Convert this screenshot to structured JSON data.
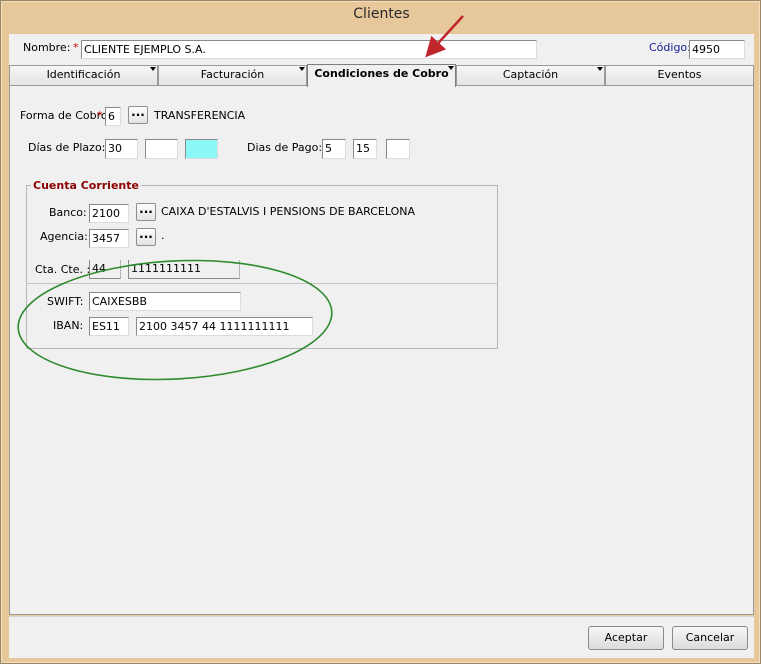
{
  "window": {
    "title": "Clientes"
  },
  "client": {
    "nombre_label": "Nombre:",
    "nombre_value": "CLIENTE EJEMPLO S.A.",
    "codigo_label": "Código:",
    "codigo_value": "4950",
    "required_mark": "*"
  },
  "tabs": [
    {
      "label": "Identificación"
    },
    {
      "label": "Facturación"
    },
    {
      "label": "Condiciones de Cobro"
    },
    {
      "label": "Captación"
    },
    {
      "label": "Eventos"
    }
  ],
  "cobro": {
    "forma_label": "Forma de Cobro:",
    "forma_code": "6",
    "forma_desc": "TRANSFERENCIA",
    "dias_plazo_label": "Días de Plazo:",
    "dias_plazo": [
      "30",
      "",
      ""
    ],
    "dias_pago_label": "Dias de Pago:",
    "dias_pago": [
      "5",
      "15",
      ""
    ],
    "dots": "..."
  },
  "cuenta": {
    "title": "Cuenta Corriente",
    "banco_label": "Banco:",
    "banco_code": "2100",
    "banco_name": "CAIXA D'ESTALVIS I PENSIONS DE BARCELONA",
    "agencia_label": "Agencia:",
    "agencia_code": "3457",
    "agencia_name": ".",
    "cta_label": "Cta. Cte. :",
    "cta_dc": "44",
    "cta_num": "1111111111",
    "swift_label": "SWIFT:",
    "swift": "CAIXESBB",
    "iban_label": "IBAN:",
    "iban_prefix": "ES11",
    "iban_rest": "2100 3457 44 1111111111"
  },
  "buttons": {
    "aceptar": "Aceptar",
    "cancelar": "Cancelar"
  },
  "colors": {
    "frame": "#e7c89b",
    "required": "#cc0000",
    "group_title": "#8b0000",
    "highlight_field": "#8bf8f8",
    "annotation_arrow": "#c0272d",
    "annotation_ellipse": "#2e8b2e"
  }
}
